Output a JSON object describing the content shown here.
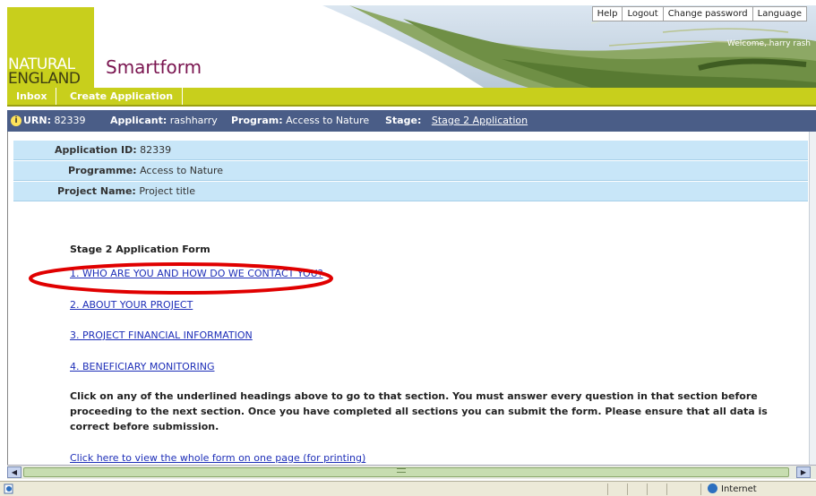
{
  "header": {
    "logo_line1": "NATURAL",
    "logo_line2": "ENGLAND",
    "app_title": "Smartform",
    "top_links": [
      "Help",
      "Logout",
      "Change password",
      "Language"
    ],
    "welcome": "Welcome, harry rash"
  },
  "tabs": {
    "inbox": "Inbox",
    "create": "Create Application"
  },
  "urn_bar": {
    "urn_label": "URN:",
    "urn_value": "82339",
    "applicant_label": "Applicant:",
    "applicant_value": "rashharry",
    "program_label": "Program:",
    "program_value": "Access to Nature",
    "stage_label": "Stage:",
    "stage_value": "Stage 2 Application"
  },
  "info": {
    "application_id_label": "Application ID:",
    "application_id_value": "82339",
    "programme_label": "Programme:",
    "programme_value": "Access to Nature",
    "project_name_label": "Project Name:",
    "project_name_value": "Project title"
  },
  "form": {
    "heading": "Stage 2 Application Form",
    "sections": [
      "1. WHO ARE YOU AND HOW DO WE CONTACT YOU?",
      "2. ABOUT YOUR PROJECT",
      "3. PROJECT FINANCIAL INFORMATION",
      "4. BENEFICIARY MONITORING"
    ],
    "instructions": "Click on any of the underlined headings above to go to that section. You must answer every question in that section before proceeding to the next section. Once you have completed all sections you can submit the form. Please ensure that all data is correct before submission.",
    "print_link": "Click here to view the whole form on one page (for printing)"
  },
  "statusbar": {
    "zone": "Internet"
  },
  "colors": {
    "brand_lime": "#c8cf1c",
    "brand_purple": "#7a1550",
    "urn_bar": "#4a5d87",
    "info_row": "#c8e6f8",
    "link": "#1e2fb8",
    "highlight": "#e00000"
  }
}
